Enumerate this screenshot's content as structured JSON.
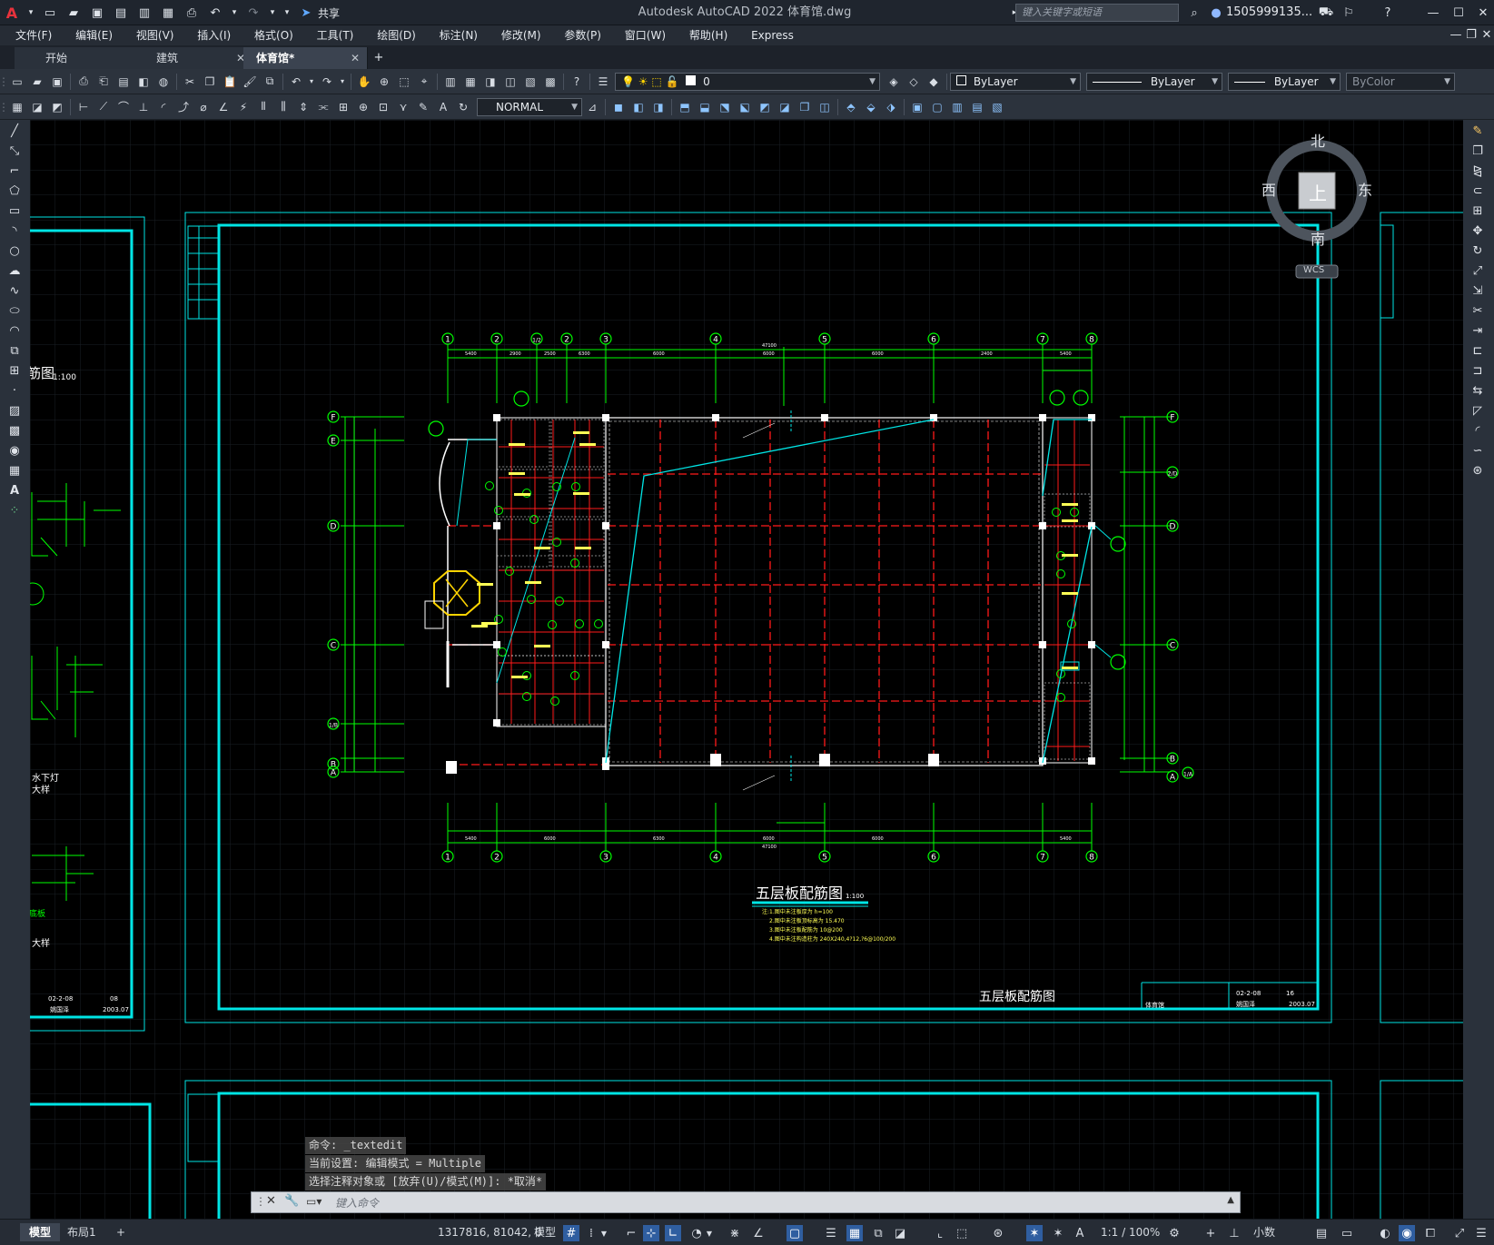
{
  "app": {
    "title": "Autodesk AutoCAD 2022    体育馆.dwg",
    "share_label": "共享",
    "search_placeholder": "键入关键字或短语",
    "user": "1505999135...",
    "colors": {
      "accent": "#2f5ea0",
      "canvas": "#000000",
      "frame": "#00e5e5",
      "dim": "#00ff00",
      "beam": "#ff1a1a"
    }
  },
  "menu": [
    "文件(F)",
    "编辑(E)",
    "视图(V)",
    "插入(I)",
    "格式(O)",
    "工具(T)",
    "绘图(D)",
    "标注(N)",
    "修改(M)",
    "参数(P)",
    "窗口(W)",
    "帮助(H)",
    "Express"
  ],
  "tabs": [
    {
      "label": "开始",
      "closable": false
    },
    {
      "label": "建筑",
      "closable": true
    },
    {
      "label": "体育馆*",
      "closable": true,
      "active": true
    }
  ],
  "toolbar": {
    "layer_value": "0",
    "color_value": "ByLayer",
    "linetype_value": "ByLayer",
    "lineweight_value": "ByLayer",
    "plotstyle_value": "ByColor",
    "text_style_value": "NORMAL"
  },
  "viewcube": {
    "north": "北",
    "south": "南",
    "east": "东",
    "west": "西",
    "top": "上",
    "wcs": "WCS"
  },
  "drawing": {
    "main_title": "五层板配筋图",
    "main_scale": "1:100",
    "titleblock_name": "五层板配筋图",
    "titleblock_project": "体育馆",
    "titleblock_no": "16",
    "titleblock_code": "02-2-08",
    "titleblock_date": "2003.07",
    "titleblock_person": "姚国泽",
    "left_sheet_no": "08",
    "left_sheet_code": "02-2-08",
    "left_sheet_date": "2003.07",
    "left_sheet_person": "姚国泽",
    "left_title_frag": "筋图",
    "left_scale": "1:100",
    "left_label_1": "水下灯",
    "left_label_2": "大样",
    "left_label_3": "大样",
    "left_label_4": "底板",
    "notes": [
      "注:1.图中未注板厚为  h=100",
      "2.图中未注板顶标高为  15.470",
      "3.图中未注板配筋为  10@200",
      "4.图中未注构造柱为  240X240,4?12,?6@100/200"
    ],
    "axis_top": [
      "1",
      "2",
      "1/2",
      "2",
      "3",
      "4",
      "5",
      "6",
      "7",
      "8"
    ],
    "axis_bottom": [
      "1",
      "2",
      "3",
      "4",
      "5",
      "6",
      "7",
      "8"
    ],
    "axis_left": [
      "F",
      "E",
      "D",
      "C",
      "1/B",
      "B",
      "A"
    ],
    "axis_right": [
      "F",
      "2/D",
      "D",
      "C",
      "B",
      "A",
      "1/A"
    ],
    "total_dim": "47100",
    "dims_top": [
      "5400",
      "2900",
      "2500",
      "6300",
      "6000",
      "6000",
      "6000",
      "2400",
      "5400"
    ],
    "dims_bottom": [
      "5400",
      "6000",
      "6300",
      "6000",
      "6000",
      "5400"
    ]
  },
  "command": {
    "history": [
      "命令: _textedit",
      "当前设置: 编辑模式 = Multiple",
      "选择注释对象或 [放弃(U)/模式(M)]: *取消*"
    ],
    "placeholder": "键入命令"
  },
  "status": {
    "model_tab": "模型",
    "layout_tab": "布局1",
    "coords": "1317816, 81042, 0",
    "space": "模型",
    "scale": "1:1 / 100%",
    "units": "小数"
  }
}
